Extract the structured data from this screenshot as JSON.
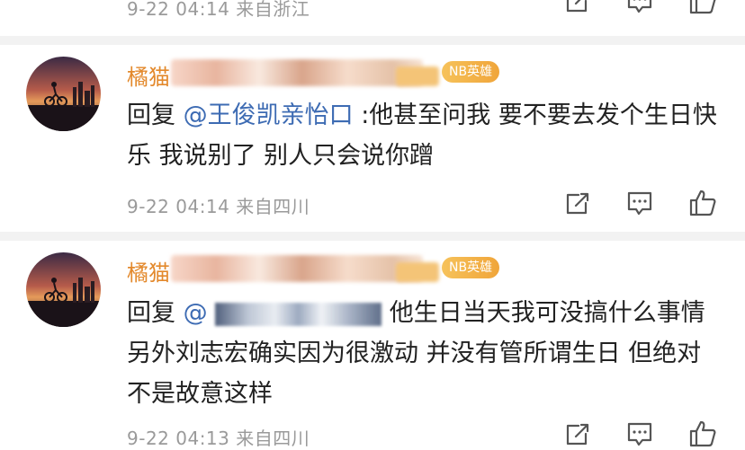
{
  "colors": {
    "name": "#e3892c",
    "mention": "#3d6bb3",
    "meta": "#9a9a9a",
    "badge": "#f0a53a",
    "divider": "#f2f2f2"
  },
  "top_partial": {
    "meta": "9-22 04:14  来自浙江"
  },
  "comments": [
    {
      "author": "橘猫",
      "badge": "NB英雄",
      "reply_prefix": "回复",
      "mention": "@王俊凯亲怡口",
      "text": ":他甚至问我 要不要去发个生日快乐 我说别了 别人只会说你蹭",
      "meta": "9-22 04:14  来自四川"
    },
    {
      "author": "橘猫",
      "badge": "NB英雄",
      "reply_prefix": "回复",
      "mention": "@",
      "text": "他生日当天我可没搞什么事情 另外刘志宏确实因为很激动 并没有管所谓生日 但绝对不是故意这样",
      "meta": "9-22 04:13  来自四川"
    }
  ],
  "actions": {
    "share_icon": "share-icon",
    "comment_icon": "comment-icon",
    "like_icon": "like-icon"
  }
}
